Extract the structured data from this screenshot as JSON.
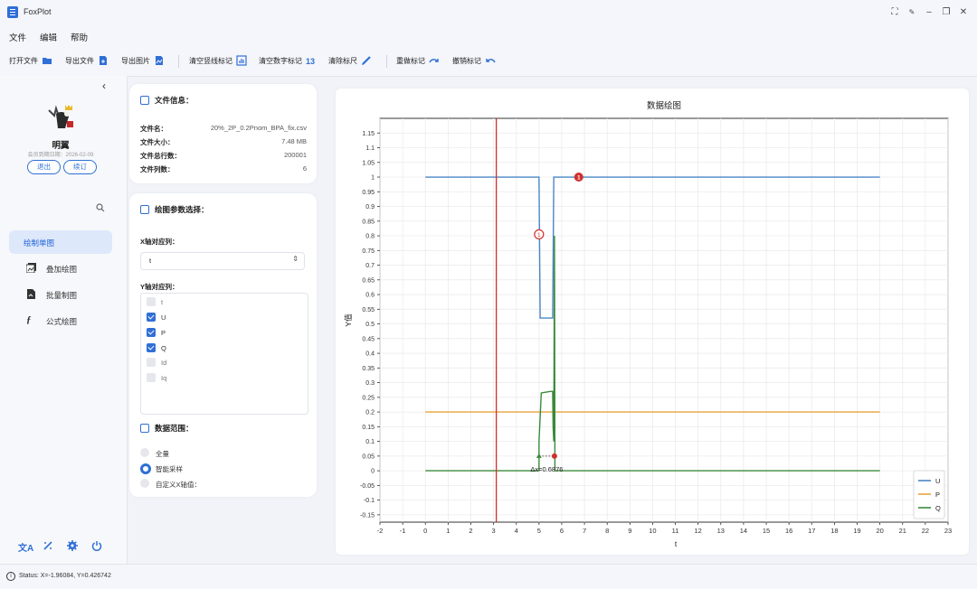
{
  "window": {
    "title": "FoxPlot"
  },
  "menu": [
    "文件",
    "编辑",
    "帮助"
  ],
  "toolbar": [
    {
      "label": "打开文件",
      "icon": "folder-open-icon"
    },
    {
      "label": "导出文件",
      "icon": "file-export-icon"
    },
    {
      "label": "导出图片",
      "icon": "image-export-icon"
    },
    {
      "label": "清空竖线标记",
      "icon": "vertical-lines-chart-icon"
    },
    {
      "label": "清空数字标记",
      "icon": "number-markers-icon"
    },
    {
      "label": "清除标尺",
      "icon": "ruler-pen-icon"
    },
    {
      "label": "重做标记",
      "icon": "redo-icon"
    },
    {
      "label": "撤销标记",
      "icon": "undo-icon"
    }
  ],
  "sidebar": {
    "user": {
      "name": "明翼",
      "expiry": "会员到期日期：2026-02-09",
      "logout": "退出",
      "renew": "续订"
    },
    "nav": [
      {
        "label": "绘制单图",
        "icon": "single-chart-icon",
        "active": true
      },
      {
        "label": "叠加绘图",
        "icon": "overlay-chart-icon",
        "active": false
      },
      {
        "label": "批量制图",
        "icon": "batch-chart-icon",
        "active": false
      },
      {
        "label": "公式绘图",
        "icon": "formula-icon",
        "active": false
      }
    ],
    "bottom_icons": [
      "translate-icon",
      "magic-wand-icon",
      "settings-icon",
      "power-icon"
    ]
  },
  "file_info": {
    "title": "文件信息：",
    "rows": [
      {
        "key": "文件名：",
        "value": "20%_2P_0.2Pnom_BPA_fix.csv"
      },
      {
        "key": "文件大小：",
        "value": "7.48 MB"
      },
      {
        "key": "文件总行数：",
        "value": "200001"
      },
      {
        "key": "文件列数：",
        "value": "6"
      }
    ]
  },
  "plot_params": {
    "title": "绘图参数选择：",
    "x_label": "X轴对应列：",
    "x_value": "t",
    "y_label": "Y轴对应列：",
    "y_columns": [
      {
        "name": "t",
        "checked": false
      },
      {
        "name": "U",
        "checked": true
      },
      {
        "name": "P",
        "checked": true
      },
      {
        "name": "Q",
        "checked": true
      },
      {
        "name": "Id",
        "checked": false
      },
      {
        "name": "Iq",
        "checked": false
      }
    ],
    "range_title": "数据范围：",
    "range_options": [
      {
        "label": "全量",
        "selected": false
      },
      {
        "label": "智能采样",
        "selected": true
      },
      {
        "label": "自定义X轴值：",
        "selected": false
      }
    ]
  },
  "status": {
    "text": "Status: X=-1.96084, Y=0.426742"
  },
  "chart_data": {
    "type": "line",
    "title": "数据绘图",
    "xlabel": "t",
    "ylabel": "Y值",
    "xlim": [
      -2,
      23
    ],
    "ylim": [
      -0.175,
      1.2
    ],
    "xticks": [
      -2,
      -1,
      0,
      1,
      2,
      3,
      4,
      5,
      6,
      7,
      8,
      9,
      10,
      11,
      12,
      13,
      14,
      15,
      16,
      17,
      18,
      19,
      20,
      21,
      22,
      23
    ],
    "yticks": [
      -0.15,
      -0.1,
      -0.05,
      0,
      0.05,
      0.1,
      0.15,
      0.2,
      0.25,
      0.3,
      0.35,
      0.4,
      0.45,
      0.5,
      0.55,
      0.6,
      0.65,
      0.7,
      0.75,
      0.8,
      0.85,
      0.9,
      0.95,
      1,
      1.05,
      1.1,
      1.15
    ],
    "ytick_labels": [
      "-0.15",
      "-0.1",
      "-0.05",
      "0",
      "0.05",
      "0.1",
      "0.15",
      "0.2",
      "0.25",
      "0.3",
      "0.35",
      "0.4",
      "0.45",
      "0.5",
      "0.55",
      "0.6",
      "0.65",
      "0.7",
      "0.75",
      "0.8",
      "0.85",
      "0.9",
      "0.95",
      "1",
      "1.05",
      "1.1",
      "1.15"
    ],
    "grid": true,
    "legend_position": "bottom-right",
    "series": [
      {
        "name": "U",
        "color": "#4a86c5",
        "x": [
          0,
          5.0,
          5.05,
          5.6,
          5.65,
          20
        ],
        "y": [
          1,
          1,
          0.52,
          0.52,
          1,
          1
        ]
      },
      {
        "name": "P",
        "color": "#e8a33d",
        "x": [
          0,
          20
        ],
        "y": [
          0.2,
          0.2
        ]
      },
      {
        "name": "Q",
        "color": "#3a8a3a",
        "x": [
          0,
          5.0,
          5.0,
          5.1,
          5.5,
          5.6,
          5.62,
          5.65,
          5.68,
          5.7,
          20
        ],
        "y": [
          0,
          0,
          0.1,
          0.265,
          0.27,
          0.27,
          0.15,
          0.1,
          0.8,
          0,
          0
        ]
      }
    ],
    "vline": {
      "x": 3.12,
      "color": "#d0312d"
    },
    "markers": [
      {
        "label": "1",
        "x": 5.0,
        "y": 0.805,
        "style": "hollow"
      },
      {
        "label": "1",
        "x": 6.75,
        "y": 1.0,
        "style": "filled"
      }
    ],
    "ruler": {
      "x1": 5.0,
      "x2": 5.68,
      "y": 0.05,
      "label": "Δx=0.6876"
    }
  }
}
